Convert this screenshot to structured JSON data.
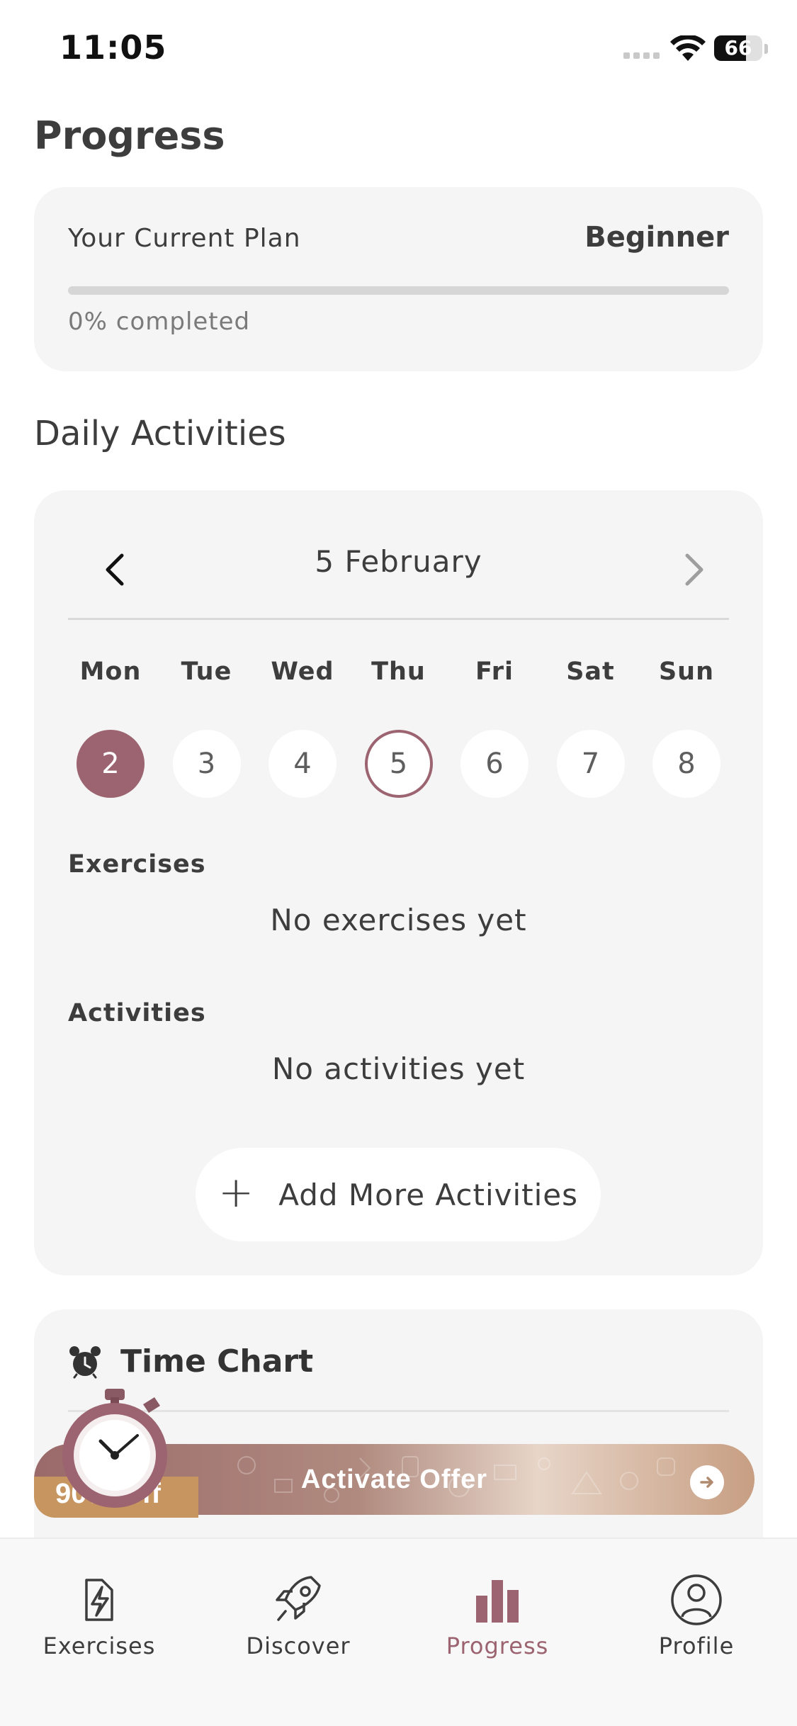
{
  "status_bar": {
    "time": "11:05",
    "battery": "66",
    "battery_level": 0.66
  },
  "page": {
    "title": "Progress"
  },
  "plan": {
    "label": "Your Current Plan",
    "value": "Beginner",
    "progress_fraction": 0.0,
    "completed_text": "0% completed"
  },
  "daily": {
    "section_title": "Daily Activities",
    "date_label": "5 February",
    "weekdays": [
      "Mon",
      "Tue",
      "Wed",
      "Thu",
      "Fri",
      "Sat",
      "Sun"
    ],
    "days": [
      "2",
      "3",
      "4",
      "5",
      "6",
      "7",
      "8"
    ],
    "selected_day": "2",
    "today_day": "5",
    "exercises_label": "Exercises",
    "exercises_empty": "No exercises yet",
    "activities_label": "Activities",
    "activities_empty": "No activities yet",
    "add_button_label": "Add More Activities"
  },
  "time_chart": {
    "title": "Time Chart"
  },
  "offer": {
    "label": "Activate Offer",
    "badge": "90% Off"
  },
  "tabs": [
    {
      "label": "Exercises",
      "icon": "lightning-icon",
      "active": false
    },
    {
      "label": "Discover",
      "icon": "rocket-icon",
      "active": false
    },
    {
      "label": "Progress",
      "icon": "bar-chart-icon",
      "active": true
    },
    {
      "label": "Profile",
      "icon": "profile-icon",
      "active": false
    }
  ],
  "colors": {
    "accent": "#9c6370",
    "card": "#f5f5f5",
    "offer_badge": "#c79560"
  }
}
